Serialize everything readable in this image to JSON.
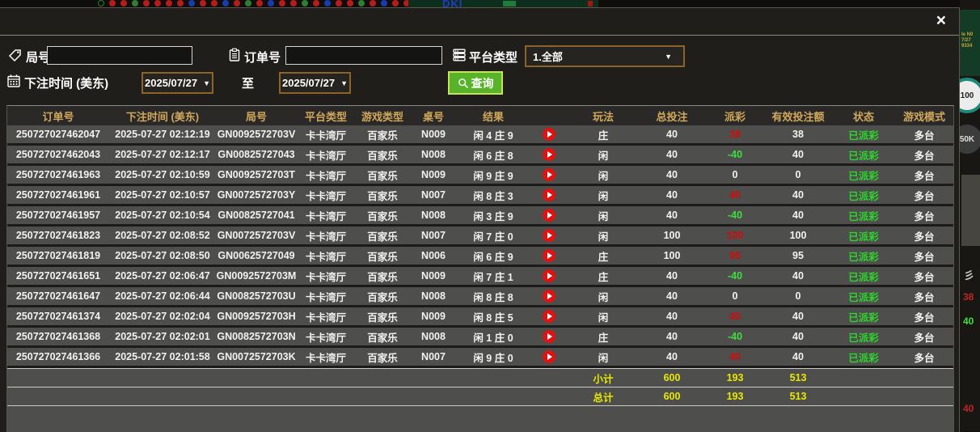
{
  "backdrop": {
    "logo_text": "DKI",
    "right_strip": {
      "chip_100_label": "100",
      "chip_50k_label": "50K",
      "side_num_1": "38",
      "side_num_2": "40",
      "side_num_3": "40"
    }
  },
  "modal": {
    "close_label": "×",
    "filters": {
      "round_label": "局号",
      "order_label": "订单号",
      "platform_label": "平台类型",
      "platform_value": "1.全部",
      "bet_time_label": "下注时间 (美东)",
      "date_from_value": "2025/07/27",
      "to_label": "至",
      "date_to_value": "2025/07/27",
      "search_label": "查询",
      "dropdown_arrow": "▼"
    }
  },
  "table": {
    "headers": [
      "订单号",
      "下注时间 (美东)",
      "局号",
      "平台类型",
      "游戏类型",
      "桌号",
      "结果",
      "",
      "玩法",
      "总投注",
      "派彩",
      "有效投注额",
      "状态",
      "游戏模式"
    ],
    "rows": [
      {
        "no": "250727027462047",
        "time": "2025-07-27 02:12:19",
        "round": "GN0092572703V",
        "hall": "卡卡湾厅",
        "game": "百家乐",
        "table": "N009",
        "result": "闲 4 庄 9",
        "bet": "庄",
        "total": "40",
        "payout": "38",
        "payoutColor": "pos",
        "valid": "38",
        "status": "已派彩",
        "mode": "多台"
      },
      {
        "no": "250727027462043",
        "time": "2025-07-27 02:12:17",
        "round": "GN00825727043",
        "hall": "卡卡湾厅",
        "game": "百家乐",
        "table": "N008",
        "result": "闲 6 庄 8",
        "bet": "闲",
        "total": "40",
        "payout": "-40",
        "payoutColor": "neg",
        "valid": "40",
        "status": "已派彩",
        "mode": "多台"
      },
      {
        "no": "250727027461963",
        "time": "2025-07-27 02:10:59",
        "round": "GN0092572703T",
        "hall": "卡卡湾厅",
        "game": "百家乐",
        "table": "N009",
        "result": "闲 9 庄 9",
        "bet": "闲",
        "total": "40",
        "payout": "0",
        "payoutColor": "zero",
        "valid": "0",
        "status": "已派彩",
        "mode": "多台"
      },
      {
        "no": "250727027461961",
        "time": "2025-07-27 02:10:57",
        "round": "GN0072572703Y",
        "hall": "卡卡湾厅",
        "game": "百家乐",
        "table": "N007",
        "result": "闲 8 庄 3",
        "bet": "闲",
        "total": "40",
        "payout": "40",
        "payoutColor": "pos",
        "valid": "40",
        "status": "已派彩",
        "mode": "多台"
      },
      {
        "no": "250727027461957",
        "time": "2025-07-27 02:10:54",
        "round": "GN00825727041",
        "hall": "卡卡湾厅",
        "game": "百家乐",
        "table": "N008",
        "result": "闲 3 庄 9",
        "bet": "闲",
        "total": "40",
        "payout": "-40",
        "payoutColor": "neg",
        "valid": "40",
        "status": "已派彩",
        "mode": "多台"
      },
      {
        "no": "250727027461823",
        "time": "2025-07-27 02:08:52",
        "round": "GN0072572703V",
        "hall": "卡卡湾厅",
        "game": "百家乐",
        "table": "N007",
        "result": "闲 7 庄 0",
        "bet": "闲",
        "total": "100",
        "payout": "100",
        "payoutColor": "pos",
        "valid": "100",
        "status": "已派彩",
        "mode": "多台"
      },
      {
        "no": "250727027461819",
        "time": "2025-07-27 02:08:50",
        "round": "GN00625727049",
        "hall": "卡卡湾厅",
        "game": "百家乐",
        "table": "N006",
        "result": "闲 6 庄 9",
        "bet": "庄",
        "total": "100",
        "payout": "95",
        "payoutColor": "pos",
        "valid": "95",
        "status": "已派彩",
        "mode": "多台"
      },
      {
        "no": "250727027461651",
        "time": "2025-07-27 02:06:47",
        "round": "GN0092572703M",
        "hall": "卡卡湾厅",
        "game": "百家乐",
        "table": "N009",
        "result": "闲 7 庄 1",
        "bet": "庄",
        "total": "40",
        "payout": "-40",
        "payoutColor": "neg",
        "valid": "40",
        "status": "已派彩",
        "mode": "多台"
      },
      {
        "no": "250727027461647",
        "time": "2025-07-27 02:06:44",
        "round": "GN0082572703U",
        "hall": "卡卡湾厅",
        "game": "百家乐",
        "table": "N008",
        "result": "闲 8 庄 8",
        "bet": "闲",
        "total": "40",
        "payout": "0",
        "payoutColor": "zero",
        "valid": "0",
        "status": "已派彩",
        "mode": "多台"
      },
      {
        "no": "250727027461374",
        "time": "2025-07-27 02:02:04",
        "round": "GN0092572703H",
        "hall": "卡卡湾厅",
        "game": "百家乐",
        "table": "N009",
        "result": "闲 8 庄 5",
        "bet": "闲",
        "total": "40",
        "payout": "40",
        "payoutColor": "pos",
        "valid": "40",
        "status": "已派彩",
        "mode": "多台"
      },
      {
        "no": "250727027461368",
        "time": "2025-07-27 02:02:01",
        "round": "GN0082572703N",
        "hall": "卡卡湾厅",
        "game": "百家乐",
        "table": "N008",
        "result": "闲 1 庄 0",
        "bet": "庄",
        "total": "40",
        "payout": "-40",
        "payoutColor": "neg",
        "valid": "40",
        "status": "已派彩",
        "mode": "多台"
      },
      {
        "no": "250727027461366",
        "time": "2025-07-27 02:01:58",
        "round": "GN0072572703K",
        "hall": "卡卡湾厅",
        "game": "百家乐",
        "table": "N007",
        "result": "闲 9 庄 0",
        "bet": "闲",
        "total": "40",
        "payout": "40",
        "payoutColor": "pos",
        "valid": "40",
        "status": "已派彩",
        "mode": "多台"
      }
    ],
    "subtotal": {
      "label": "小计",
      "total_bet": "600",
      "payout": "193",
      "valid_bet": "513"
    },
    "total": {
      "label": "总计",
      "total_bet": "600",
      "payout": "193",
      "valid_bet": "513"
    }
  },
  "colors": {
    "payout_win": "#d40b0b",
    "payout_loss": "#3fdf3f",
    "payout_zero": "#f2f2f2",
    "status_paid": "#2ed52e",
    "summary_yellow": "#e8e800",
    "header_gold": "#d0a85c",
    "search_button_green": "#58b32a",
    "select_border_orange": "#8d6427",
    "row_gray": "#4e4e4c"
  }
}
